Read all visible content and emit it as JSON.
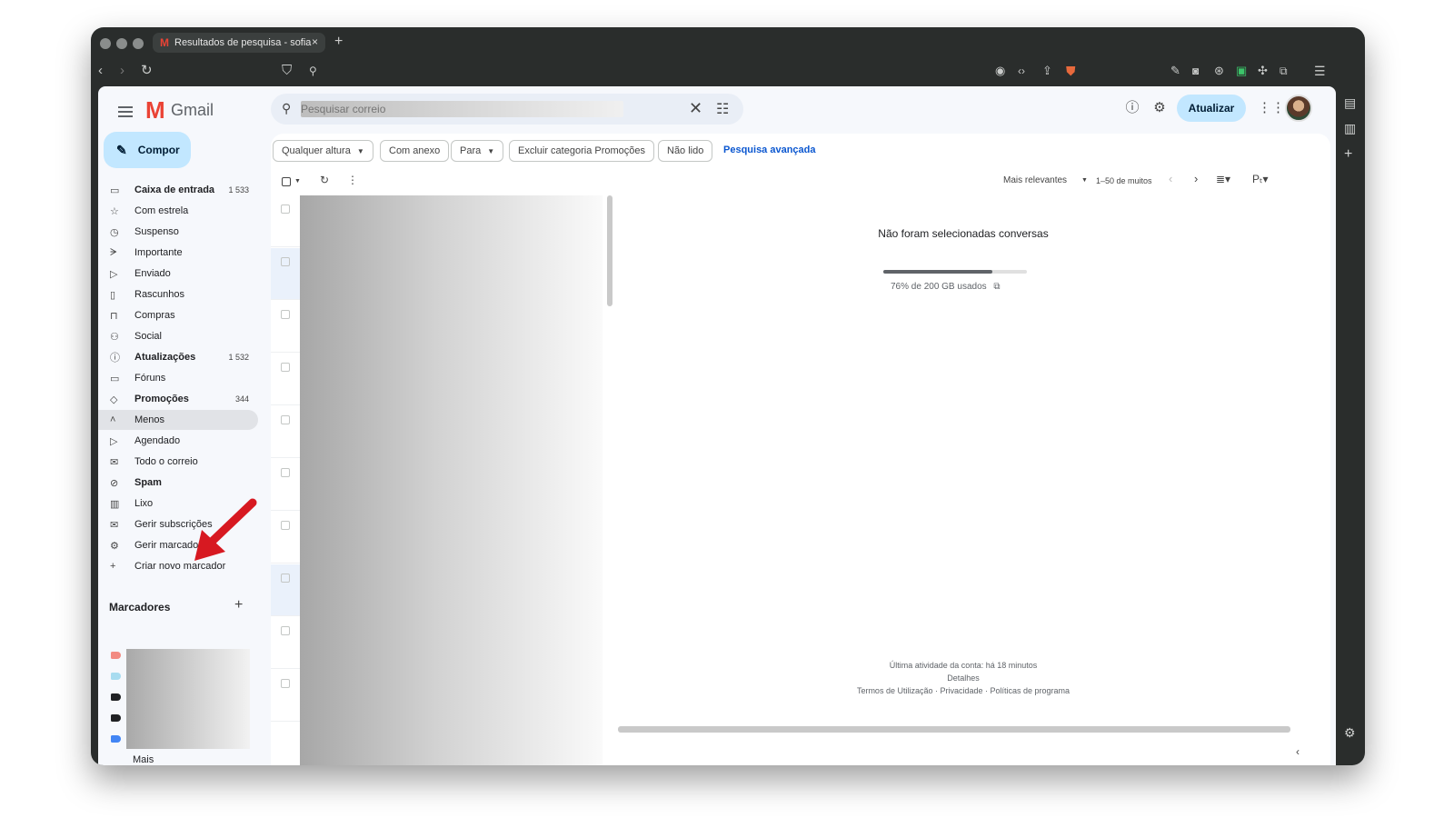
{
  "browser": {
    "tab_title": "Resultados de pesquisa - sofia",
    "tab_close": "×",
    "new_tab": "+"
  },
  "gmail": {
    "product_name": "Gmail",
    "search": {
      "placeholder": "Pesquisar correio",
      "value": ""
    },
    "update_button": "Atualizar",
    "compose_label": "Compor",
    "nav": [
      {
        "label": "Caixa de entrada",
        "count": "1 533",
        "icon": "inbox-icon",
        "bold": true
      },
      {
        "label": "Com estrela",
        "count": "",
        "icon": "star-icon",
        "bold": false
      },
      {
        "label": "Suspenso",
        "count": "",
        "icon": "clock-icon",
        "bold": false
      },
      {
        "label": "Importante",
        "count": "",
        "icon": "important-icon",
        "bold": false
      },
      {
        "label": "Enviado",
        "count": "",
        "icon": "send-icon",
        "bold": false
      },
      {
        "label": "Rascunhos",
        "count": "",
        "icon": "draft-icon",
        "bold": false
      },
      {
        "label": "Compras",
        "count": "",
        "icon": "shopping-bag-icon",
        "bold": false
      },
      {
        "label": "Social",
        "count": "",
        "icon": "people-icon",
        "bold": false
      },
      {
        "label": "Atualizações",
        "count": "1 532",
        "icon": "info-icon",
        "bold": true
      },
      {
        "label": "Fóruns",
        "count": "",
        "icon": "forum-icon",
        "bold": false
      },
      {
        "label": "Promoções",
        "count": "344",
        "icon": "tag-icon",
        "bold": true
      },
      {
        "label": "Menos",
        "count": "",
        "icon": "chevron-up-icon",
        "bold": false
      },
      {
        "label": "Agendado",
        "count": "",
        "icon": "scheduled-icon",
        "bold": false
      },
      {
        "label": "Todo o correio",
        "count": "",
        "icon": "all-mail-icon",
        "bold": false
      },
      {
        "label": "Spam",
        "count": "",
        "icon": "spam-icon",
        "bold": true
      },
      {
        "label": "Lixo",
        "count": "",
        "icon": "trash-icon",
        "bold": false
      },
      {
        "label": "Gerir subscrições",
        "count": "",
        "icon": "manage-subscriptions-icon",
        "bold": false
      },
      {
        "label": "Gerir marcadores",
        "count": "",
        "icon": "settings-cog-icon",
        "bold": false
      },
      {
        "label": "Criar novo marcador",
        "count": "",
        "icon": "plus-icon",
        "bold": false
      }
    ],
    "labels_heading": "Marcadores",
    "labels_more": "Mais",
    "label_colors": [
      "#f28b82",
      "#a8dcf0",
      "#202124",
      "#202124",
      "#4285f4"
    ],
    "filter_chips": [
      {
        "label": "Qualquer altura",
        "dropdown": true
      },
      {
        "label": "Com anexo",
        "dropdown": false
      },
      {
        "label": "Para",
        "dropdown": true
      },
      {
        "label": "Excluir categoria Promoções",
        "dropdown": false
      },
      {
        "label": "Não lido",
        "dropdown": false
      }
    ],
    "advanced_search": "Pesquisa avançada",
    "sort_label": "Mais relevantes",
    "pagination": "1–50 de muitos",
    "list_rows": 10,
    "reading_pane": {
      "no_selection": "Não foram selecionadas conversas",
      "storage_fraction": 0.76,
      "storage_text": "76% de 200 GB usados",
      "last_activity": "Última atividade da conta: há 18 minutos",
      "details": "Detalhes",
      "footer_links": "Termos de Utilização · Privacidade · Políticas de programa"
    },
    "accent_color": "#c2e7ff",
    "annotation_arrow_color": "#d71921"
  }
}
